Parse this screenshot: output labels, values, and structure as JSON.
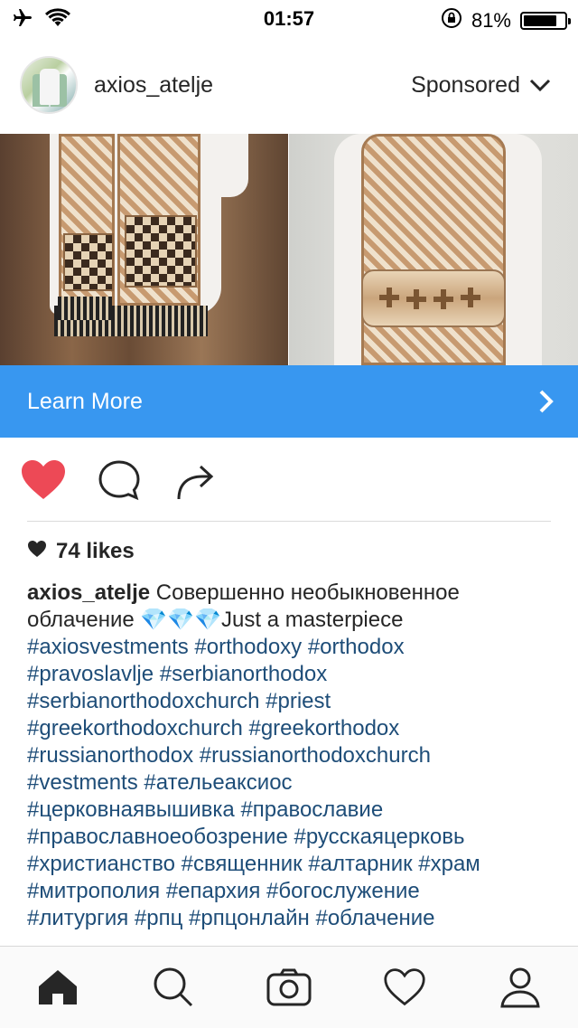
{
  "status_bar": {
    "time": "01:57",
    "battery_percent": "81%",
    "battery_level": 0.81
  },
  "post": {
    "username": "axios_atelje",
    "sponsored_label": "Sponsored",
    "cta_label": "Learn More",
    "likes_label": "74 likes",
    "liked": true,
    "caption_user": "axios_atelje",
    "caption_text": "Совершенно необыкновенное облачение 💎💎💎Just a masterpiece",
    "hashtag_lines": [
      "#axiosvestments #orthodoxy #orthodox",
      "#pravoslavlje #serbianorthodox",
      "#serbianorthodoxchurch #priest",
      "#greekorthodoxchurch #greekorthodox",
      "#russianorthodox #russianorthodoxchurch",
      "#vestments #ательеаксиос",
      "#церковнаявышивка #православие",
      "#православноеобозрение #русскаяцерковь",
      "#христианство #священник #алтарник #храм",
      "#митрополия #епархия #богослужение",
      "#литургия #рпц #рпцонлайн #облачение"
    ]
  },
  "icons": {
    "status": [
      "airplane-icon",
      "wifi-icon",
      "orientation-lock-icon",
      "battery-icon"
    ],
    "actions": [
      "heart-filled-icon",
      "comment-icon",
      "share-icon"
    ],
    "nav": [
      "home-icon",
      "search-icon",
      "camera-icon",
      "activity-heart-icon",
      "profile-icon"
    ]
  },
  "colors": {
    "accent": "#3897f0",
    "like": "#ed4956",
    "hashtag": "#1e4d78"
  }
}
